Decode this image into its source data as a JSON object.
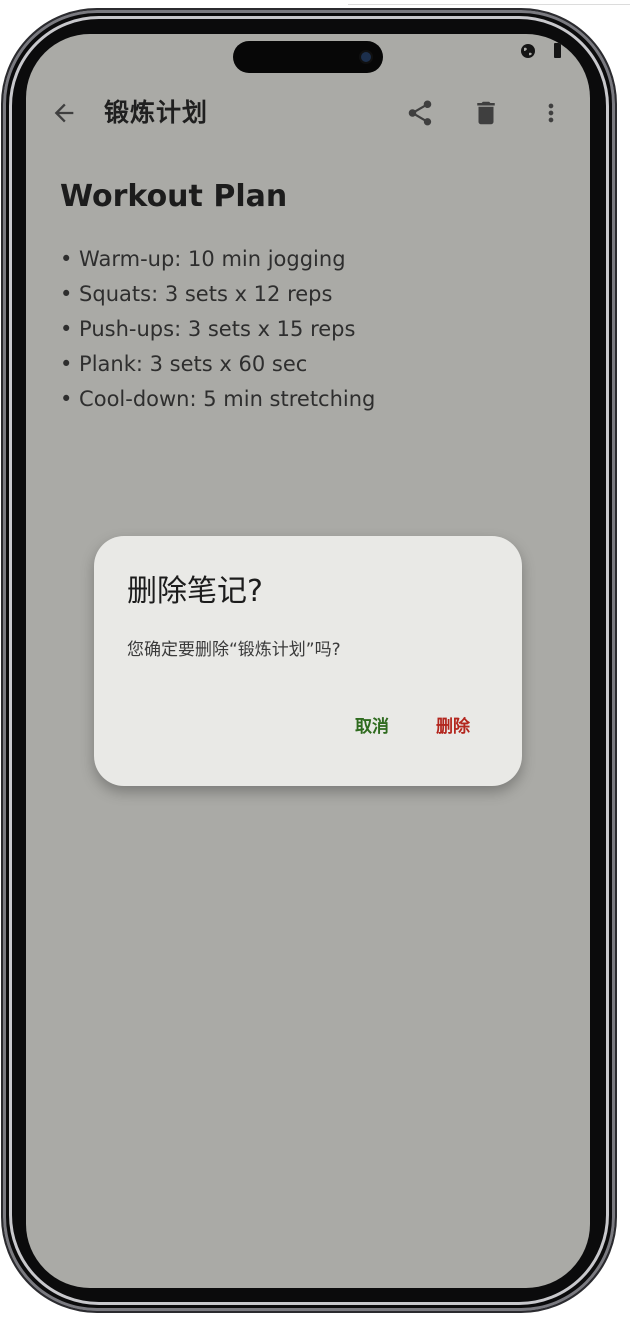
{
  "app_bar": {
    "title": "锻炼计划",
    "back_icon": "arrow-back-icon",
    "share_icon": "share-icon",
    "delete_icon": "trash-icon",
    "more_icon": "more-vert-icon"
  },
  "status_bar": {
    "globe_icon": "globe-icon",
    "battery_icon": "battery-icon"
  },
  "note": {
    "heading": "Workout Plan",
    "items": [
      "• Warm-up: 10 min jogging",
      "• Squats: 3 sets x 12 reps",
      "• Push-ups: 3 sets x 15 reps",
      "• Plank: 3 sets x 60 sec",
      "• Cool-down: 5 min stretching"
    ]
  },
  "dialog": {
    "title": "删除笔记?",
    "message": "您确定要删除“锻炼计划”吗?",
    "cancel_label": "取消",
    "confirm_label": "删除"
  },
  "colors": {
    "scrim": "#aaaaa6",
    "dialog_bg": "#e9e9e6",
    "cancel_text": "#2f6b1f",
    "confirm_text": "#b3261e",
    "icon": "#3f3f3f"
  }
}
